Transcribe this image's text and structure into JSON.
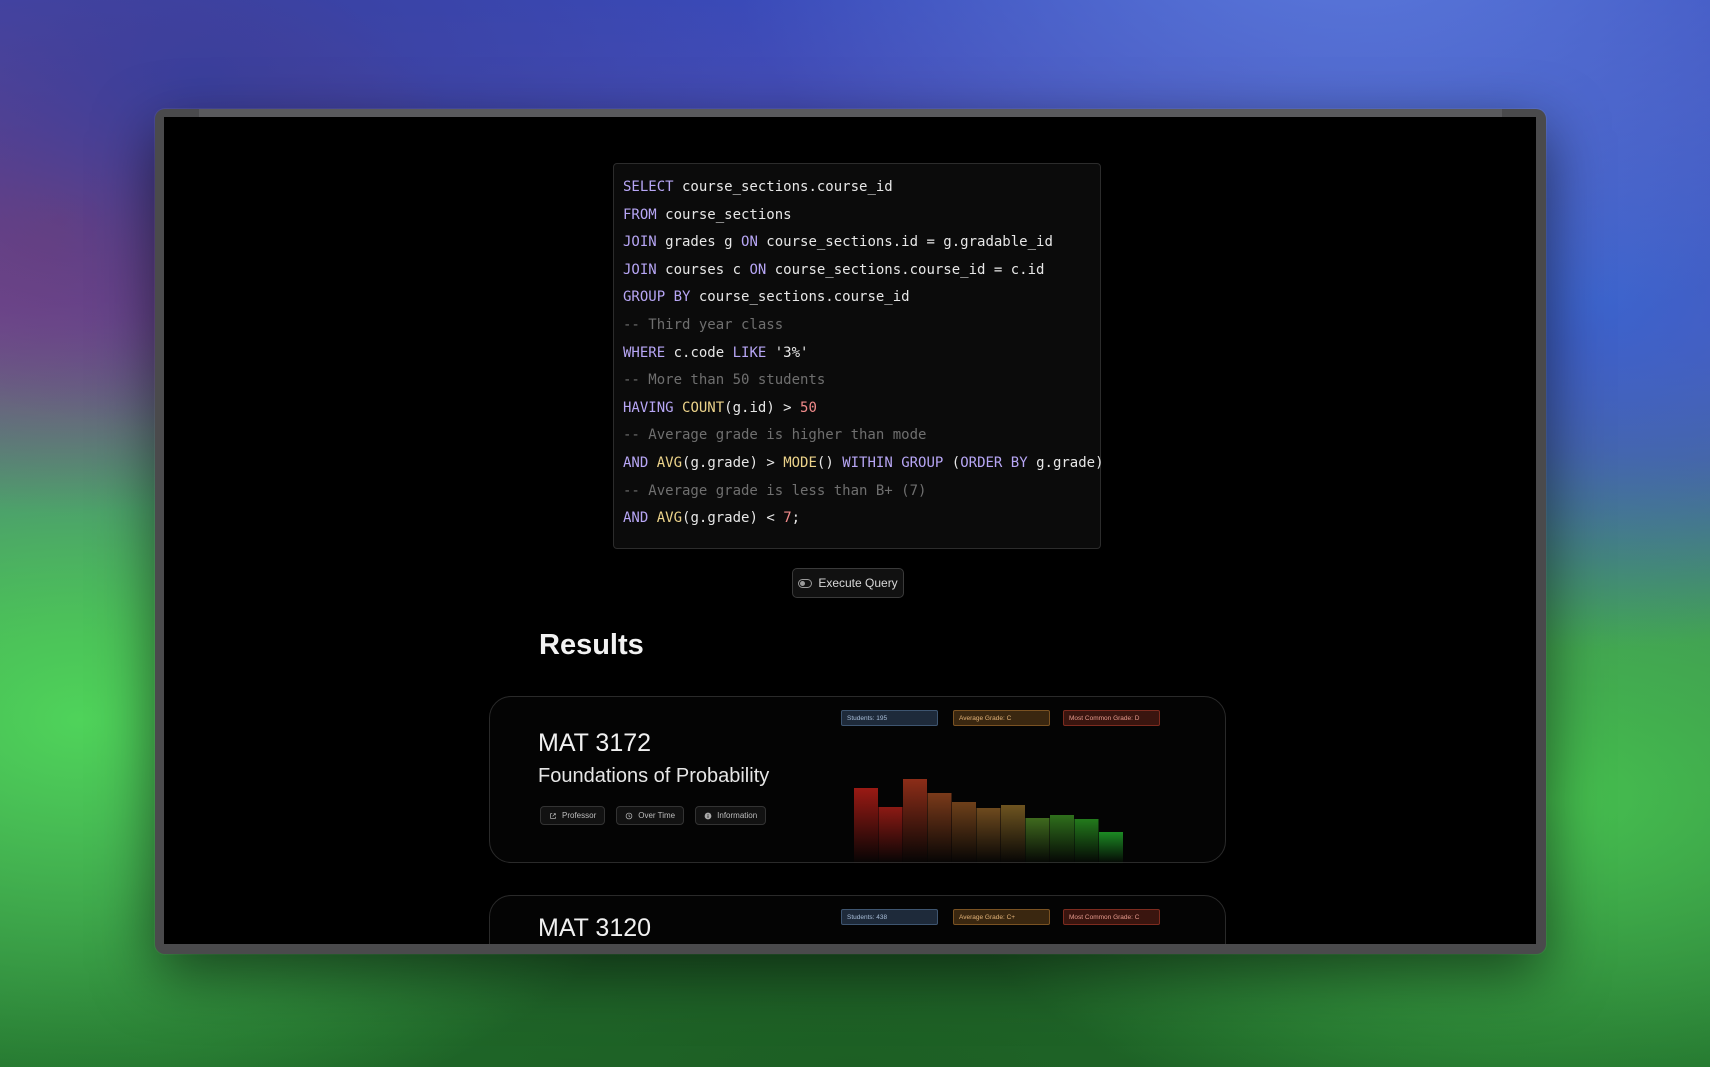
{
  "code": {
    "lines": [
      [
        {
          "t": "kw",
          "v": "SELECT"
        },
        {
          "t": "str",
          "v": " course_sections.course_id"
        }
      ],
      [
        {
          "t": "kw",
          "v": "FROM"
        },
        {
          "t": "str",
          "v": " course_sections"
        }
      ],
      [
        {
          "t": "kw",
          "v": "JOIN"
        },
        {
          "t": "str",
          "v": " grades g "
        },
        {
          "t": "kw",
          "v": "ON"
        },
        {
          "t": "str",
          "v": " course_sections.id = g.gradable_id"
        }
      ],
      [
        {
          "t": "kw",
          "v": "JOIN"
        },
        {
          "t": "str",
          "v": " courses c "
        },
        {
          "t": "kw",
          "v": "ON"
        },
        {
          "t": "str",
          "v": " course_sections.course_id = c.id"
        }
      ],
      [
        {
          "t": "kw",
          "v": "GROUP BY"
        },
        {
          "t": "str",
          "v": " course_sections.course_id"
        }
      ],
      [
        {
          "t": "cm",
          "v": "-- Third year class"
        }
      ],
      [
        {
          "t": "kw",
          "v": "WHERE"
        },
        {
          "t": "str",
          "v": " c.code "
        },
        {
          "t": "kw",
          "v": "LIKE"
        },
        {
          "t": "str",
          "v": " '3%'"
        }
      ],
      [
        {
          "t": "cm",
          "v": "-- More than 50 students"
        }
      ],
      [
        {
          "t": "kw",
          "v": "HAVING"
        },
        {
          "t": "str",
          "v": " "
        },
        {
          "t": "fn",
          "v": "COUNT"
        },
        {
          "t": "str",
          "v": "(g.id) > "
        },
        {
          "t": "num",
          "v": "50"
        }
      ],
      [
        {
          "t": "cm",
          "v": "-- Average grade is higher than mode"
        }
      ],
      [
        {
          "t": "kw",
          "v": "AND"
        },
        {
          "t": "str",
          "v": " "
        },
        {
          "t": "fn",
          "v": "AVG"
        },
        {
          "t": "str",
          "v": "(g.grade) > "
        },
        {
          "t": "fn",
          "v": "MODE"
        },
        {
          "t": "str",
          "v": "() "
        },
        {
          "t": "kw",
          "v": "WITHIN GROUP"
        },
        {
          "t": "str",
          "v": " ("
        },
        {
          "t": "kw",
          "v": "ORDER BY"
        },
        {
          "t": "str",
          "v": " g.grade)"
        }
      ],
      [
        {
          "t": "cm",
          "v": "-- Average grade is less than B+ (7)"
        }
      ],
      [
        {
          "t": "kw",
          "v": "AND"
        },
        {
          "t": "str",
          "v": " "
        },
        {
          "t": "fn",
          "v": "AVG"
        },
        {
          "t": "str",
          "v": "(g.grade) < "
        },
        {
          "t": "num",
          "v": "7"
        },
        {
          "t": "str",
          "v": ";"
        }
      ]
    ]
  },
  "execute_button": {
    "label": "Execute Query",
    "icon": "toggle-icon"
  },
  "results": {
    "title": "Results",
    "cards": [
      {
        "code": "MAT 3172",
        "name": "Foundations of Probability",
        "badges": {
          "students": "Students: 195",
          "average": "Average Grade: C",
          "mode": "Most Common Grade: D"
        },
        "actions": [
          {
            "label": "Professor",
            "icon": "external-link-icon"
          },
          {
            "label": "Over Time",
            "icon": "history-icon"
          },
          {
            "label": "Information",
            "icon": "info-icon"
          }
        ],
        "histogram": {
          "values": [
            0.76,
            0.57,
            0.85,
            0.71,
            0.62,
            0.56,
            0.59,
            0.46,
            0.49,
            0.45,
            0.32
          ],
          "colors": [
            "#9a1a14",
            "#8c1a14",
            "#8c2d18",
            "#7a3a1a",
            "#6e401a",
            "#6e4a1e",
            "#6e5420",
            "#3f6a1e",
            "#2f6f1c",
            "#237a1c",
            "#1c8a24"
          ]
        }
      },
      {
        "code": "MAT 3120",
        "badges": {
          "students": "Students: 438",
          "average": "Average Grade: C+",
          "mode": "Most Common Grade: C"
        }
      }
    ]
  }
}
